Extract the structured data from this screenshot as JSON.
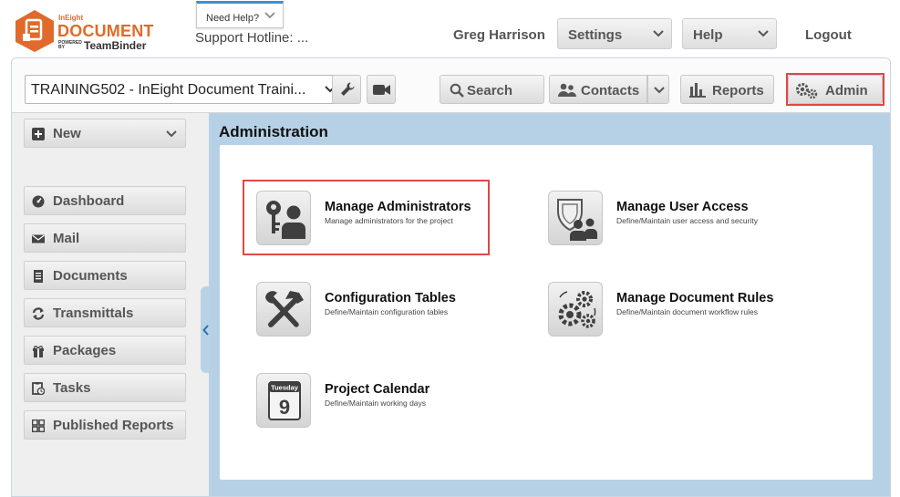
{
  "header": {
    "logo_small": "InEight",
    "logo_main": "DOCUMENT",
    "logo_powered": "POWERED BY",
    "logo_teambinder": "TeamBinder",
    "need_help": "Need Help?",
    "hotline": "Support Hotline: ...",
    "user_name": "Greg Harrison",
    "settings_label": "Settings",
    "help_label": "Help",
    "logout_label": "Logout"
  },
  "toolbar": {
    "project_selected": "TRAINING502 - InEight Document Traini...",
    "search_label": "Search",
    "contacts_label": "Contacts",
    "reports_label": "Reports",
    "admin_label": "Admin"
  },
  "sidebar": {
    "new_label": "New",
    "items": [
      {
        "label": "Dashboard",
        "icon": "dashboard-icon"
      },
      {
        "label": "Mail",
        "icon": "mail-icon"
      },
      {
        "label": "Documents",
        "icon": "documents-icon"
      },
      {
        "label": "Transmittals",
        "icon": "transmittals-icon"
      },
      {
        "label": "Packages",
        "icon": "packages-icon"
      },
      {
        "label": "Tasks",
        "icon": "tasks-icon"
      },
      {
        "label": "Published Reports",
        "icon": "published-reports-icon"
      }
    ]
  },
  "content": {
    "title": "Administration",
    "items": [
      {
        "title": "Manage Administrators",
        "desc": "Manage administrators for the project",
        "icon": "key-user-icon"
      },
      {
        "title": "Manage User Access",
        "desc": "Define/Maintain user access and security",
        "icon": "shield-users-icon"
      },
      {
        "title": "Configuration Tables",
        "desc": "Define/Maintain configuration tables",
        "icon": "tools-icon"
      },
      {
        "title": "Manage Document Rules",
        "desc": "Define/Maintain document workflow rules",
        "icon": "gears-icon"
      },
      {
        "title": "Project Calendar",
        "desc": "Define/Maintain working days",
        "icon": "calendar-icon",
        "calendar_day": "Tuesday",
        "calendar_date": "9"
      }
    ]
  },
  "colors": {
    "brand_orange": "#e06a2b",
    "highlight_red": "#e04747",
    "content_blue": "#b6d1e5",
    "help_accent": "#3b8fd3"
  }
}
